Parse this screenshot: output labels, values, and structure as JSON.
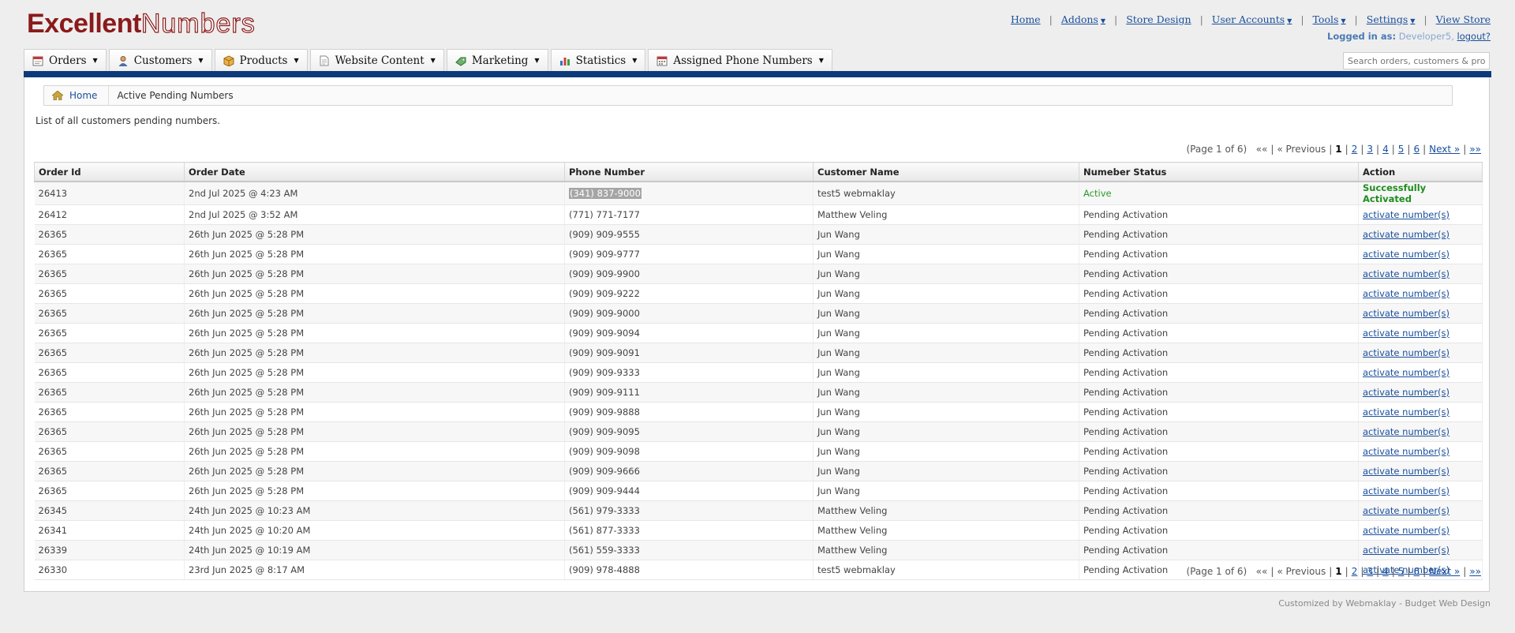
{
  "logo": {
    "part1": "Excellent",
    "part2": "Numbers"
  },
  "toplinks": [
    {
      "label": "Home",
      "dropdown": false
    },
    {
      "label": "Addons",
      "dropdown": true
    },
    {
      "label": "Store Design",
      "dropdown": false
    },
    {
      "label": "User Accounts",
      "dropdown": true
    },
    {
      "label": "Tools",
      "dropdown": true
    },
    {
      "label": "Settings",
      "dropdown": true
    },
    {
      "label": "View Store",
      "dropdown": false
    }
  ],
  "login": {
    "label": "Logged in as:",
    "user": "Developer5,",
    "logout": "logout?"
  },
  "nav": [
    {
      "label": "Orders",
      "icon": "orders-icon"
    },
    {
      "label": "Customers",
      "icon": "customers-icon"
    },
    {
      "label": "Products",
      "icon": "products-icon"
    },
    {
      "label": "Website Content",
      "icon": "document-icon"
    },
    {
      "label": "Marketing",
      "icon": "marketing-icon"
    },
    {
      "label": "Statistics",
      "icon": "chart-icon"
    },
    {
      "label": "Assigned Phone Numbers",
      "icon": "phone-numbers-icon"
    }
  ],
  "search": {
    "placeholder": "Search orders, customers & products"
  },
  "breadcrumb": {
    "home": "Home",
    "current": "Active Pending Numbers"
  },
  "intro": "List of all customers pending numbers.",
  "pager": {
    "info": "(Page 1 of 6)",
    "first": "««",
    "previous": "« Previous",
    "current": "1",
    "pages": [
      "2",
      "3",
      "4",
      "5",
      "6"
    ],
    "next": "Next »",
    "last": "»»"
  },
  "table": {
    "columns": [
      "Order Id",
      "Order Date",
      "Phone Number",
      "Customer Name",
      "Numeber Status",
      "Action"
    ],
    "rows": [
      {
        "id": "26413",
        "date": "2nd Jul 2025 @ 4:23 AM",
        "phone": "(341) 837-9000",
        "customer": "test5 webmaklay",
        "status": "Active",
        "action": "Successfully Activated",
        "selected": true
      },
      {
        "id": "26412",
        "date": "2nd Jul 2025 @ 3:52 AM",
        "phone": "(771) 771-7177",
        "customer": "Matthew Veling",
        "status": "Pending Activation",
        "action": "activate number(s)"
      },
      {
        "id": "26365",
        "date": "26th Jun 2025 @ 5:28 PM",
        "phone": "(909) 909-9555",
        "customer": "Jun Wang",
        "status": "Pending Activation",
        "action": "activate number(s)"
      },
      {
        "id": "26365",
        "date": "26th Jun 2025 @ 5:28 PM",
        "phone": "(909) 909-9777",
        "customer": "Jun Wang",
        "status": "Pending Activation",
        "action": "activate number(s)"
      },
      {
        "id": "26365",
        "date": "26th Jun 2025 @ 5:28 PM",
        "phone": "(909) 909-9900",
        "customer": "Jun Wang",
        "status": "Pending Activation",
        "action": "activate number(s)"
      },
      {
        "id": "26365",
        "date": "26th Jun 2025 @ 5:28 PM",
        "phone": "(909) 909-9222",
        "customer": "Jun Wang",
        "status": "Pending Activation",
        "action": "activate number(s)"
      },
      {
        "id": "26365",
        "date": "26th Jun 2025 @ 5:28 PM",
        "phone": "(909) 909-9000",
        "customer": "Jun Wang",
        "status": "Pending Activation",
        "action": "activate number(s)"
      },
      {
        "id": "26365",
        "date": "26th Jun 2025 @ 5:28 PM",
        "phone": "(909) 909-9094",
        "customer": "Jun Wang",
        "status": "Pending Activation",
        "action": "activate number(s)"
      },
      {
        "id": "26365",
        "date": "26th Jun 2025 @ 5:28 PM",
        "phone": "(909) 909-9091",
        "customer": "Jun Wang",
        "status": "Pending Activation",
        "action": "activate number(s)"
      },
      {
        "id": "26365",
        "date": "26th Jun 2025 @ 5:28 PM",
        "phone": "(909) 909-9333",
        "customer": "Jun Wang",
        "status": "Pending Activation",
        "action": "activate number(s)"
      },
      {
        "id": "26365",
        "date": "26th Jun 2025 @ 5:28 PM",
        "phone": "(909) 909-9111",
        "customer": "Jun Wang",
        "status": "Pending Activation",
        "action": "activate number(s)"
      },
      {
        "id": "26365",
        "date": "26th Jun 2025 @ 5:28 PM",
        "phone": "(909) 909-9888",
        "customer": "Jun Wang",
        "status": "Pending Activation",
        "action": "activate number(s)"
      },
      {
        "id": "26365",
        "date": "26th Jun 2025 @ 5:28 PM",
        "phone": "(909) 909-9095",
        "customer": "Jun Wang",
        "status": "Pending Activation",
        "action": "activate number(s)"
      },
      {
        "id": "26365",
        "date": "26th Jun 2025 @ 5:28 PM",
        "phone": "(909) 909-9098",
        "customer": "Jun Wang",
        "status": "Pending Activation",
        "action": "activate number(s)"
      },
      {
        "id": "26365",
        "date": "26th Jun 2025 @ 5:28 PM",
        "phone": "(909) 909-9666",
        "customer": "Jun Wang",
        "status": "Pending Activation",
        "action": "activate number(s)"
      },
      {
        "id": "26365",
        "date": "26th Jun 2025 @ 5:28 PM",
        "phone": "(909) 909-9444",
        "customer": "Jun Wang",
        "status": "Pending Activation",
        "action": "activate number(s)"
      },
      {
        "id": "26345",
        "date": "24th Jun 2025 @ 10:23 AM",
        "phone": "(561) 979-3333",
        "customer": "Matthew Veling",
        "status": "Pending Activation",
        "action": "activate number(s)"
      },
      {
        "id": "26341",
        "date": "24th Jun 2025 @ 10:20 AM",
        "phone": "(561) 877-3333",
        "customer": "Matthew Veling",
        "status": "Pending Activation",
        "action": "activate number(s)"
      },
      {
        "id": "26339",
        "date": "24th Jun 2025 @ 10:19 AM",
        "phone": "(561) 559-3333",
        "customer": "Matthew Veling",
        "status": "Pending Activation",
        "action": "activate number(s)"
      },
      {
        "id": "26330",
        "date": "23rd Jun 2025 @ 8:17 AM",
        "phone": "(909) 978-4888",
        "customer": "test5 webmaklay",
        "status": "Pending Activation",
        "action": "activate number(s)"
      }
    ]
  },
  "footer": "Customized by Webmaklay - Budget Web Design",
  "colors": {
    "brand": "#8b1a1a",
    "navbar": "#0d3a78",
    "link": "#1a4f9c",
    "active": "#2a9a2a"
  }
}
